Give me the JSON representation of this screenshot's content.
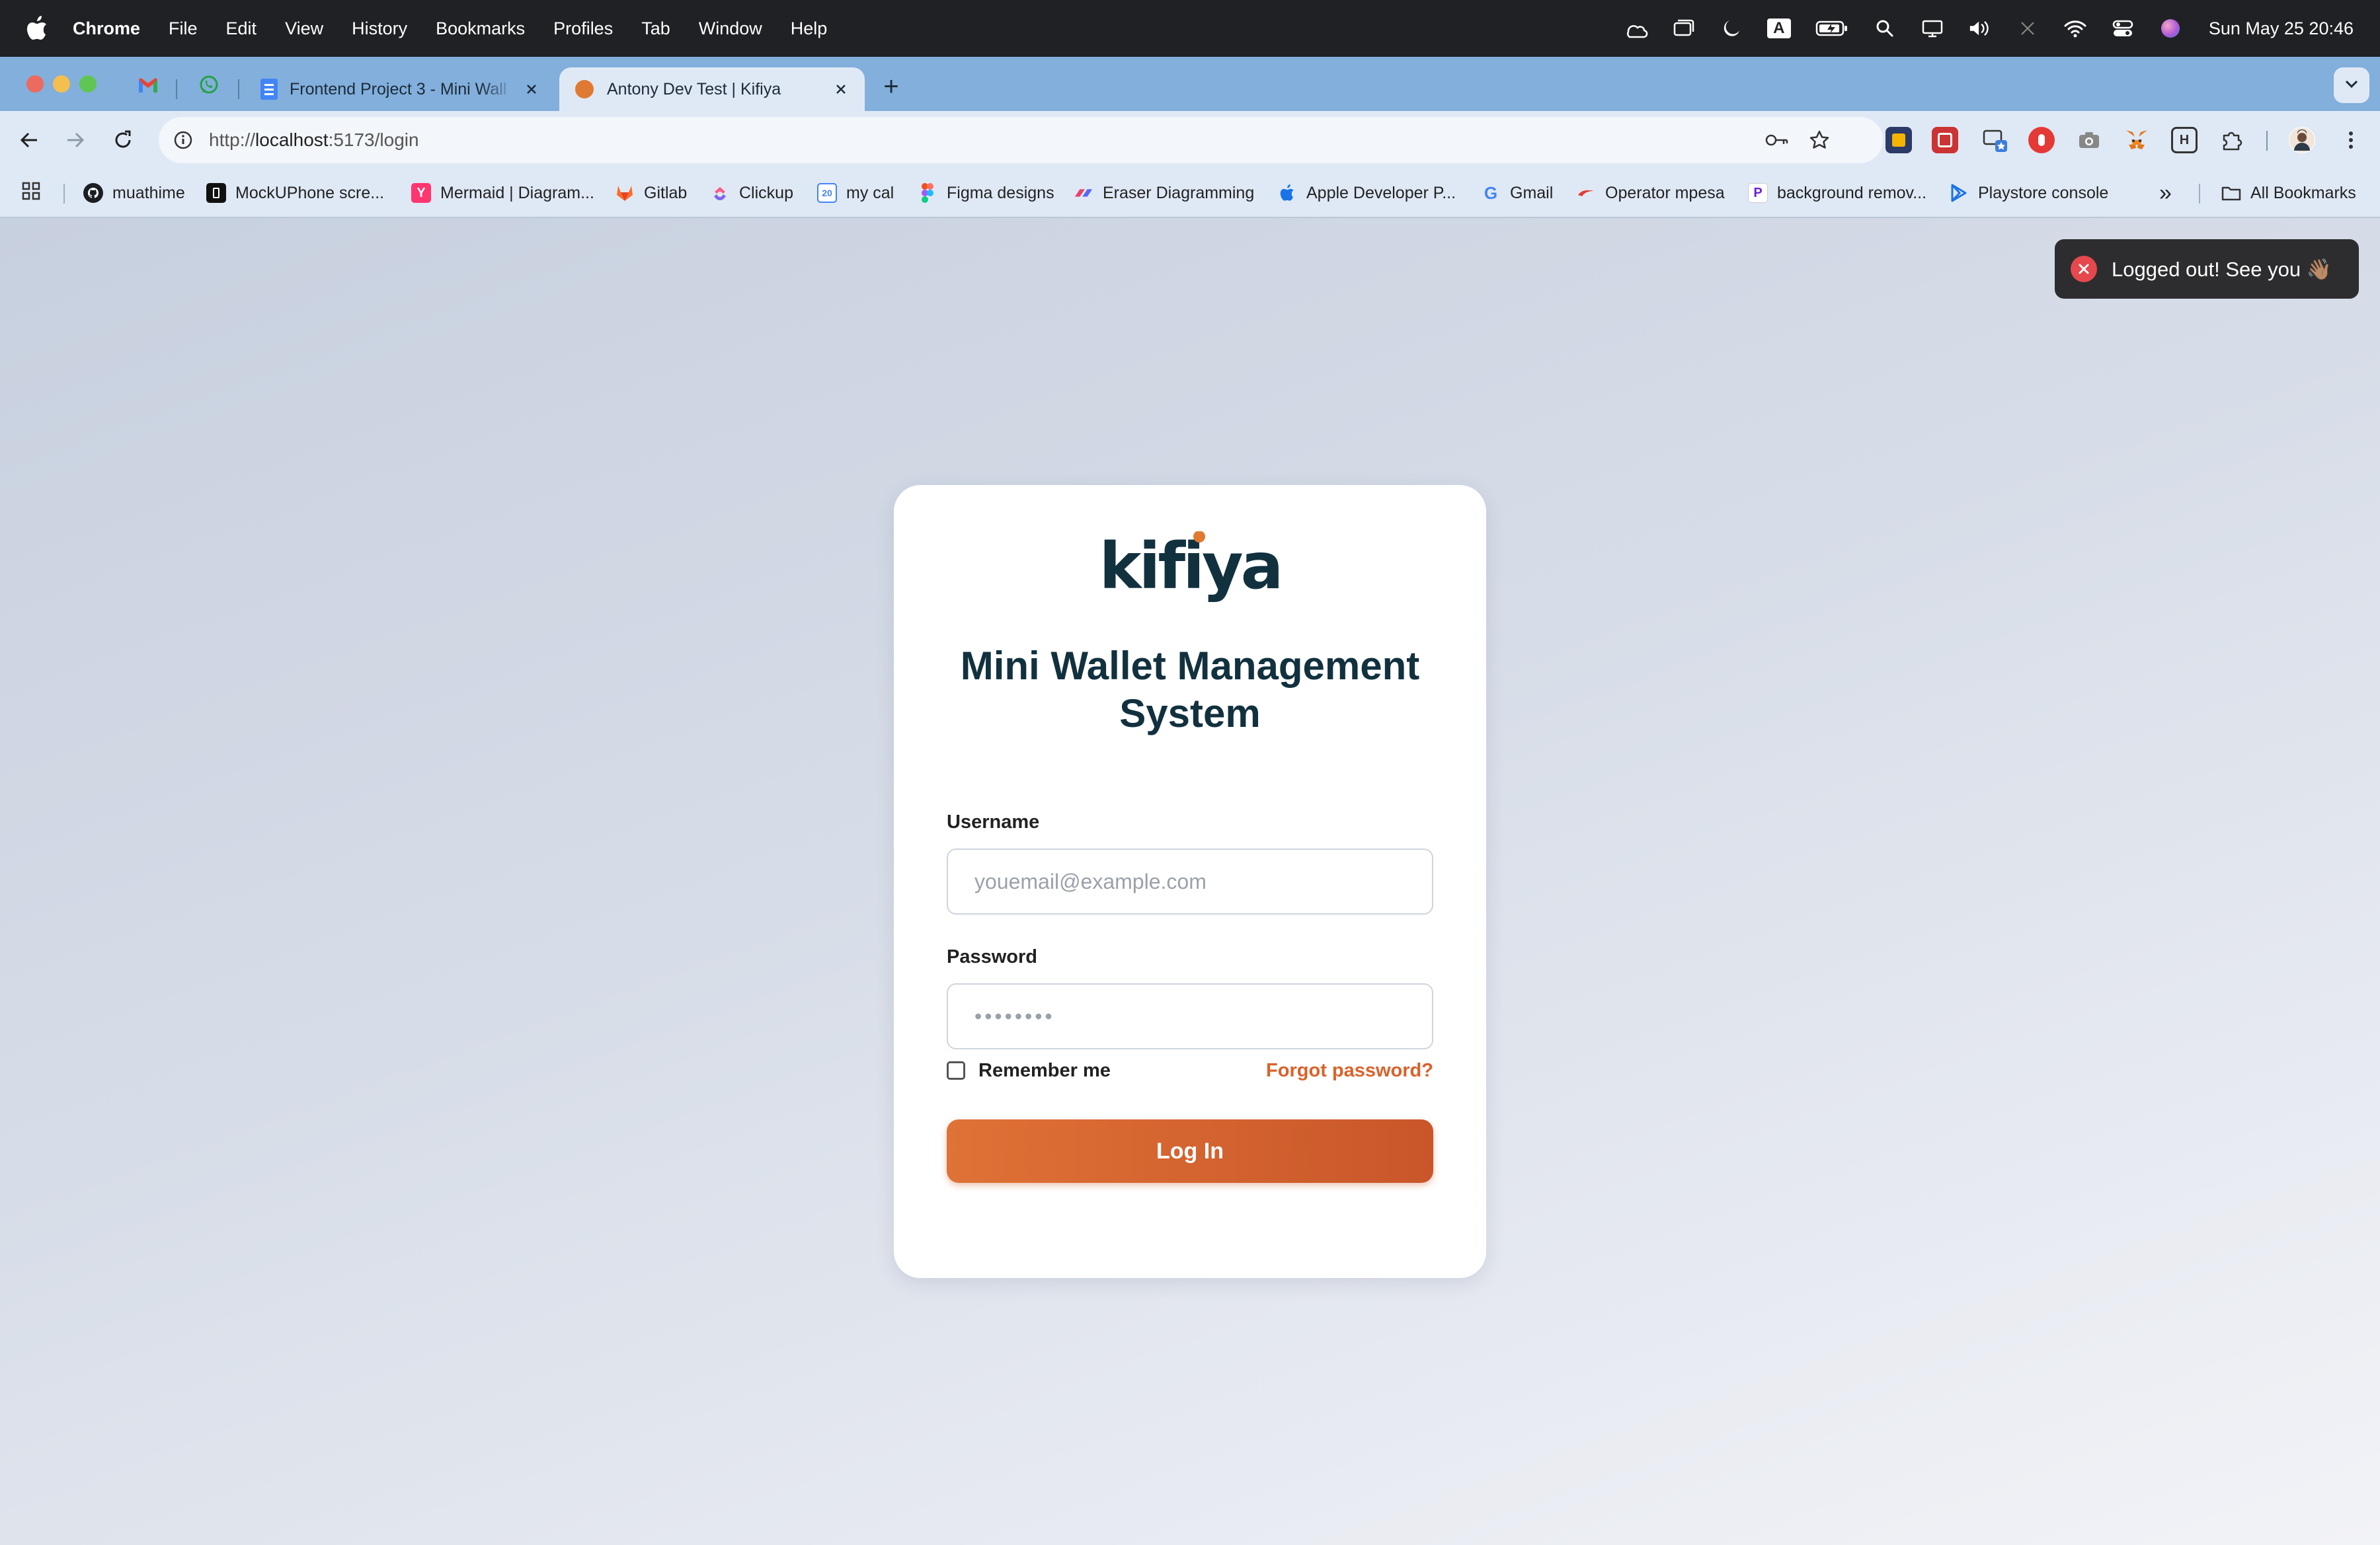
{
  "menubar": {
    "app_name": "Chrome",
    "items": [
      "File",
      "Edit",
      "View",
      "History",
      "Bookmarks",
      "Profiles",
      "Tab",
      "Window",
      "Help"
    ],
    "status_icons": [
      "accessibility-icon",
      "screen-mirror-icon",
      "moon-icon",
      "input-source-icon",
      "battery-icon",
      "spotlight-search-icon",
      "display-icon",
      "volume-icon",
      "bluetooth-icon",
      "wifi-icon",
      "control-center-icon",
      "siri-icon"
    ],
    "input_source": "A",
    "clock": "Sun May 25  20:46"
  },
  "tabs": {
    "pinned": [
      "gmail-icon",
      "whatsapp-icon"
    ],
    "items": [
      {
        "title": "Frontend Project 3 - Mini Wall",
        "icon": "docs-icon",
        "active": false
      },
      {
        "title": "Antony Dev Test | Kifiya",
        "icon": "kifiya-favicon-icon",
        "active": true
      }
    ],
    "new_tab": "+",
    "tab_search_icon": "chevron-down-icon"
  },
  "toolbar": {
    "url_scheme": "http://",
    "url_host": "localhost",
    "url_rest": ":5173/login",
    "extensions": [
      "extension-1-icon",
      "extension-2-icon",
      "extension-3-icon",
      "extension-4-icon",
      "camera-extension-icon",
      "metamask-icon",
      "extension-7-icon",
      "puzzle-icon",
      "profile-avatar-icon",
      "kebab-menu-icon"
    ]
  },
  "bookmarks": {
    "items": [
      {
        "label": "muathime",
        "icon": "github-icon"
      },
      {
        "label": "MockUPhone scre...",
        "icon": "mockuphone-icon"
      },
      {
        "label": "Mermaid | Diagram...",
        "icon": "mermaid-icon"
      },
      {
        "label": "Gitlab",
        "icon": "gitlab-icon"
      },
      {
        "label": "Clickup",
        "icon": "clickup-icon"
      },
      {
        "label": "my cal",
        "icon": "calendar-icon"
      },
      {
        "label": "Figma designs",
        "icon": "figma-icon"
      },
      {
        "label": "Eraser Diagramming",
        "icon": "eraser-icon"
      },
      {
        "label": "Apple Developer P...",
        "icon": "apple-icon"
      },
      {
        "label": "Gmail",
        "icon": "google-icon"
      },
      {
        "label": "Operator mpesa",
        "icon": "mpesa-icon"
      },
      {
        "label": "background remov...",
        "icon": "photoroom-icon"
      },
      {
        "label": "Playstore console",
        "icon": "playstore-icon"
      }
    ],
    "overflow": "»",
    "all_bookmarks": "All Bookmarks"
  },
  "toast": {
    "message": "Logged out! See you 👋🏽"
  },
  "login": {
    "logo_text": "kifiya",
    "title": "Mini Wallet Management System",
    "username_label": "Username",
    "username_placeholder": "youemail@example.com",
    "password_label": "Password",
    "password_placeholder": "••••••••",
    "remember_label": "Remember me",
    "forgot_label": "Forgot password?",
    "submit_label": "Log In"
  },
  "colors": {
    "brand_dark": "#12313f",
    "brand_orange": "#d9622b",
    "toast_error": "#e5484d"
  }
}
